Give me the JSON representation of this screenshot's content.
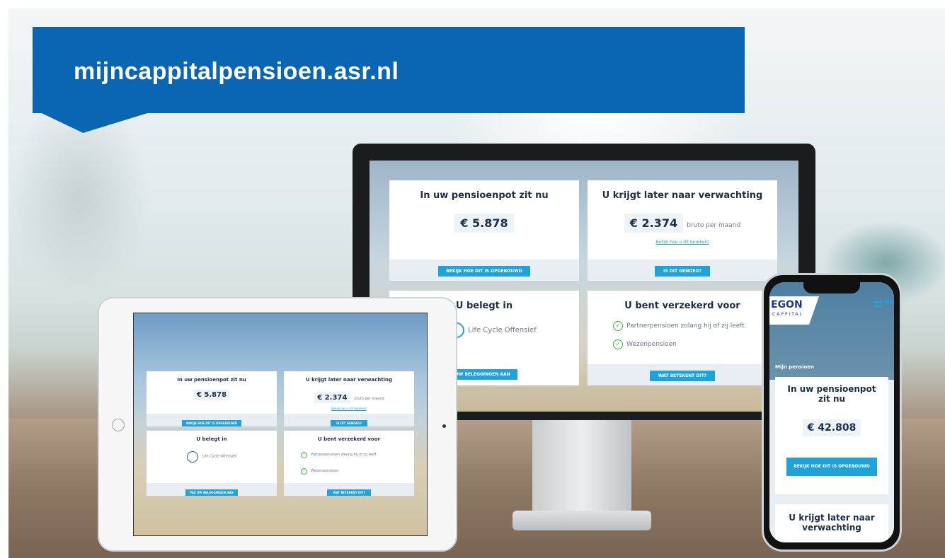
{
  "banner": {
    "url": "mijncappitalpensioen.asr.nl"
  },
  "desktop": {
    "pot": {
      "title": "In uw pensioenpot zit nu",
      "amount": "€ 5.878",
      "button": "BEKIJK HOE DIT IS OPGEBOUWD"
    },
    "expect": {
      "title": "U krijgt later naar verwachting",
      "amount": "€ 2.374",
      "unit": "bruto per maand",
      "link": "Bekijk hoe u dit berekent",
      "button": "IS DIT GENOEG?"
    },
    "invest": {
      "title": "U belegt in",
      "fund": "Life Cycle Offensief",
      "button": "PAS UW BELEGGINGEN AAN"
    },
    "insured": {
      "title": "U bent verzekerd voor",
      "items": [
        "Partnerpensioen zolang hij of zij leeft",
        "Wezenpensioen"
      ],
      "button": "WAT BETEKENT DIT?"
    }
  },
  "tablet": {
    "pot": {
      "title": "In uw pensioenpot zit nu",
      "amount": "€ 5.878",
      "button": "BEKIJK HOE DIT IS OPGEBOUWD"
    },
    "expect": {
      "title": "U krijgt later naar verwachting",
      "amount": "€ 2.374",
      "unit": "bruto per maand",
      "link": "Bekijk hoe u dit berekent",
      "button": "IS DIT GENOEG?"
    },
    "invest": {
      "title": "U belegt in",
      "fund": "Life Cycle Offensief",
      "button": "PAS UW BELEGGINGEN AAN"
    },
    "insured": {
      "title": "U bent verzekerd voor",
      "items": [
        "Partnerpensioen zolang hij of zij leeft",
        "Wezenpensioen"
      ],
      "button": "WAT BETEKENT DIT?"
    }
  },
  "phone": {
    "logo": "EGON",
    "logo_sub": "CAPPITAL",
    "menu": "ME",
    "section": "Mijn pensioen",
    "pot": {
      "title": "In uw pensioenpot zit nu",
      "amount": "€ 42.808",
      "button": "BEKIJK HOE DIT IS OPGEBOUWD"
    },
    "expect": {
      "title": "U krijgt later naar verwachting"
    }
  },
  "colors": {
    "brand_blue": "#0a66b2",
    "button_blue": "#1fa3dd",
    "check_green": "#44a843"
  }
}
